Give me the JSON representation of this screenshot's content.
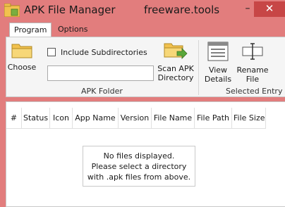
{
  "window": {
    "title": "APK File Manager",
    "subtitle": "freeware.tools",
    "minimize_glyph": "–",
    "close_glyph": "✕"
  },
  "tabs": [
    {
      "label": "Program",
      "active": true
    },
    {
      "label": "Options",
      "active": false
    }
  ],
  "ribbon": {
    "apk_folder": {
      "label": "APK Folder",
      "choose_label": "Choose",
      "include_subdirectories_label": "Include Subdirectories",
      "include_subdirectories_checked": false,
      "directory_value": "",
      "scan_label_line1": "Scan APK",
      "scan_label_line2": "Directory"
    },
    "selected_entry": {
      "label": "Selected Entry",
      "view_label_line1": "View",
      "view_label_line2": "Details",
      "rename_label_line1": "Rename",
      "rename_label_line2": "File"
    }
  },
  "list": {
    "columns": [
      "#",
      "Status",
      "Icon",
      "App Name",
      "Version",
      "File Name",
      "File Path",
      "File Size"
    ],
    "empty_message": {
      "line1": "No files displayed.",
      "line2": "Please select a directory",
      "line3": "with .apk files from above."
    }
  },
  "icons": {
    "app": "apk-app-icon",
    "choose": "folder-icon",
    "scan": "folder-arrow-icon",
    "view": "details-list-icon",
    "rename": "rename-icon"
  },
  "colors": {
    "title_bar": "#e27d7d",
    "close_button": "#c74646",
    "ribbon_bg": "#f5f5f5",
    "folder_yellow": "#f2c14e"
  }
}
